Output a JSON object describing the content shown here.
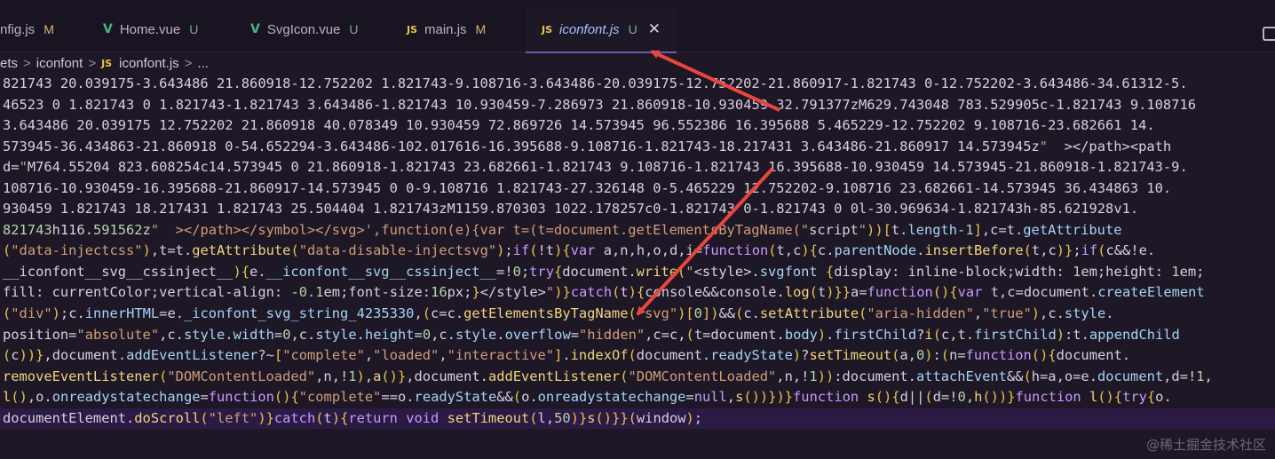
{
  "tabs": [
    {
      "label": "nfig.js",
      "icon": "js-icon",
      "badge": "M",
      "active": false
    },
    {
      "label": "Home.vue",
      "icon": "vue-icon",
      "badge": "U",
      "active": false
    },
    {
      "label": "SvgIcon.vue",
      "icon": "vue-icon",
      "badge": "U",
      "active": false
    },
    {
      "label": "main.js",
      "icon": "js-icon",
      "badge": "M",
      "active": false
    },
    {
      "label": "iconfont.js",
      "icon": "js-icon",
      "badge": "U",
      "active": true,
      "close": "✕"
    }
  ],
  "js_icon_text": "JS",
  "vue_icon_text": "V",
  "breadcrumb": {
    "items": [
      "ets",
      "iconfont",
      "iconfont.js",
      "..."
    ],
    "separator": ">"
  },
  "code": {
    "lines": [
      "821743 20.039175-3.643486 21.860918-12.752202 1.821743-9.108716-3.643486-20.039175-12.752202-21.860917-1.821743 0-12.752202-3.643486-34.61312-5.",
      "46523 0 1.821743 0 1.821743-1.821743 3.643486-1.821743 10.930459-7.286973 21.860918-10.930459 32.791377zM629.743048 783.529905c-1.821743 9.108716",
      "3.643486 20.039175 12.752202 21.860918 40.078349 10.930459 72.869726 14.573945 96.552386 16.395688 5.465229-12.752202 9.108716-23.682661 14.",
      "573945-36.434863-21.860918 0-54.652294-3.643486-102.017616-16.395688-9.108716-1.821743-18.217431 3.643486-21.860917 14.573945z\"  ></path><path",
      "d=\"M764.55204 823.608254c14.573945 0 21.860918-1.821743 23.682661-1.821743 9.108716-1.821743 16.395688-10.930459 14.573945-21.860918-1.821743-9.",
      "108716-10.930459-16.395688-21.860917-14.573945 0 0-9.108716 1.821743-27.326148 0-5.465229 12.752202-9.108716 23.682661-14.573945 36.434863 10.",
      "930459 1.821743 18.217431 1.821743 25.504404 1.821743zM1159.870303 1022.178257c0-1.821743 0-1.821743 0 0l-30.969634-1.821743h-85.621928v1.",
      "821743h116.591562z\"  ></path></symbol></svg>',function(e){var t=(t=document.getElementsByTagName(\"script\"))[t.length-1],c=t.getAttribute",
      "(\"data-injectcss\"),t=t.getAttribute(\"data-disable-injectsvg\");if(!t){var a,n,h,o,d,i=function(t,c){c.parentNode.insertBefore(t,c)};if(c&&!e.",
      "__iconfont__svg__cssinject__){e.__iconfont__svg__cssinject__=!0;try{document.write(\"<style>.svgfont {display: inline-block;width: 1em;height: 1em;",
      "fill: currentColor;vertical-align: -0.1em;font-size:16px;}</style>\")}catch(t){console&&console.log(t)}}a=function(){var t,c=document.createElement",
      "(\"div\");c.innerHTML=e._iconfont_svg_string_4235330,(c=c.getElementsByTagName(\"svg\")[0])&&(c.setAttribute(\"aria-hidden\",\"true\"),c.style.",
      "position=\"absolute\",c.style.width=0,c.style.height=0,c.style.overflow=\"hidden\",c=c,(t=document.body).firstChild?i(c,t.firstChild):t.appendChild",
      "(c))},document.addEventListener?~[\"complete\",\"loaded\",\"interactive\"].indexOf(document.readyState)?setTimeout(a,0):(n=function(){document.",
      "removeEventListener(\"DOMContentLoaded\",n,!1),a()},document.addEventListener(\"DOMContentLoaded\",n,!1)):document.attachEvent&&(h=a,o=e.document,d=!1,",
      "l(),o.onreadystatechange=function(){\"complete\"==o.readyState&&(o.onreadystatechange=null,s())})}function s(){d||(d=!0,h())}function l(){try{o.",
      "documentElement.doScroll(\"left\")}catch(t){return void setTimeout(l,50)}s()}}(window);"
    ],
    "current_line": 16
  },
  "watermark": "@稀土掘金技术社区",
  "colors": {
    "arrow": "#e8473e",
    "active_tab_text": "#9fc3ff",
    "background": "#1e1726"
  }
}
